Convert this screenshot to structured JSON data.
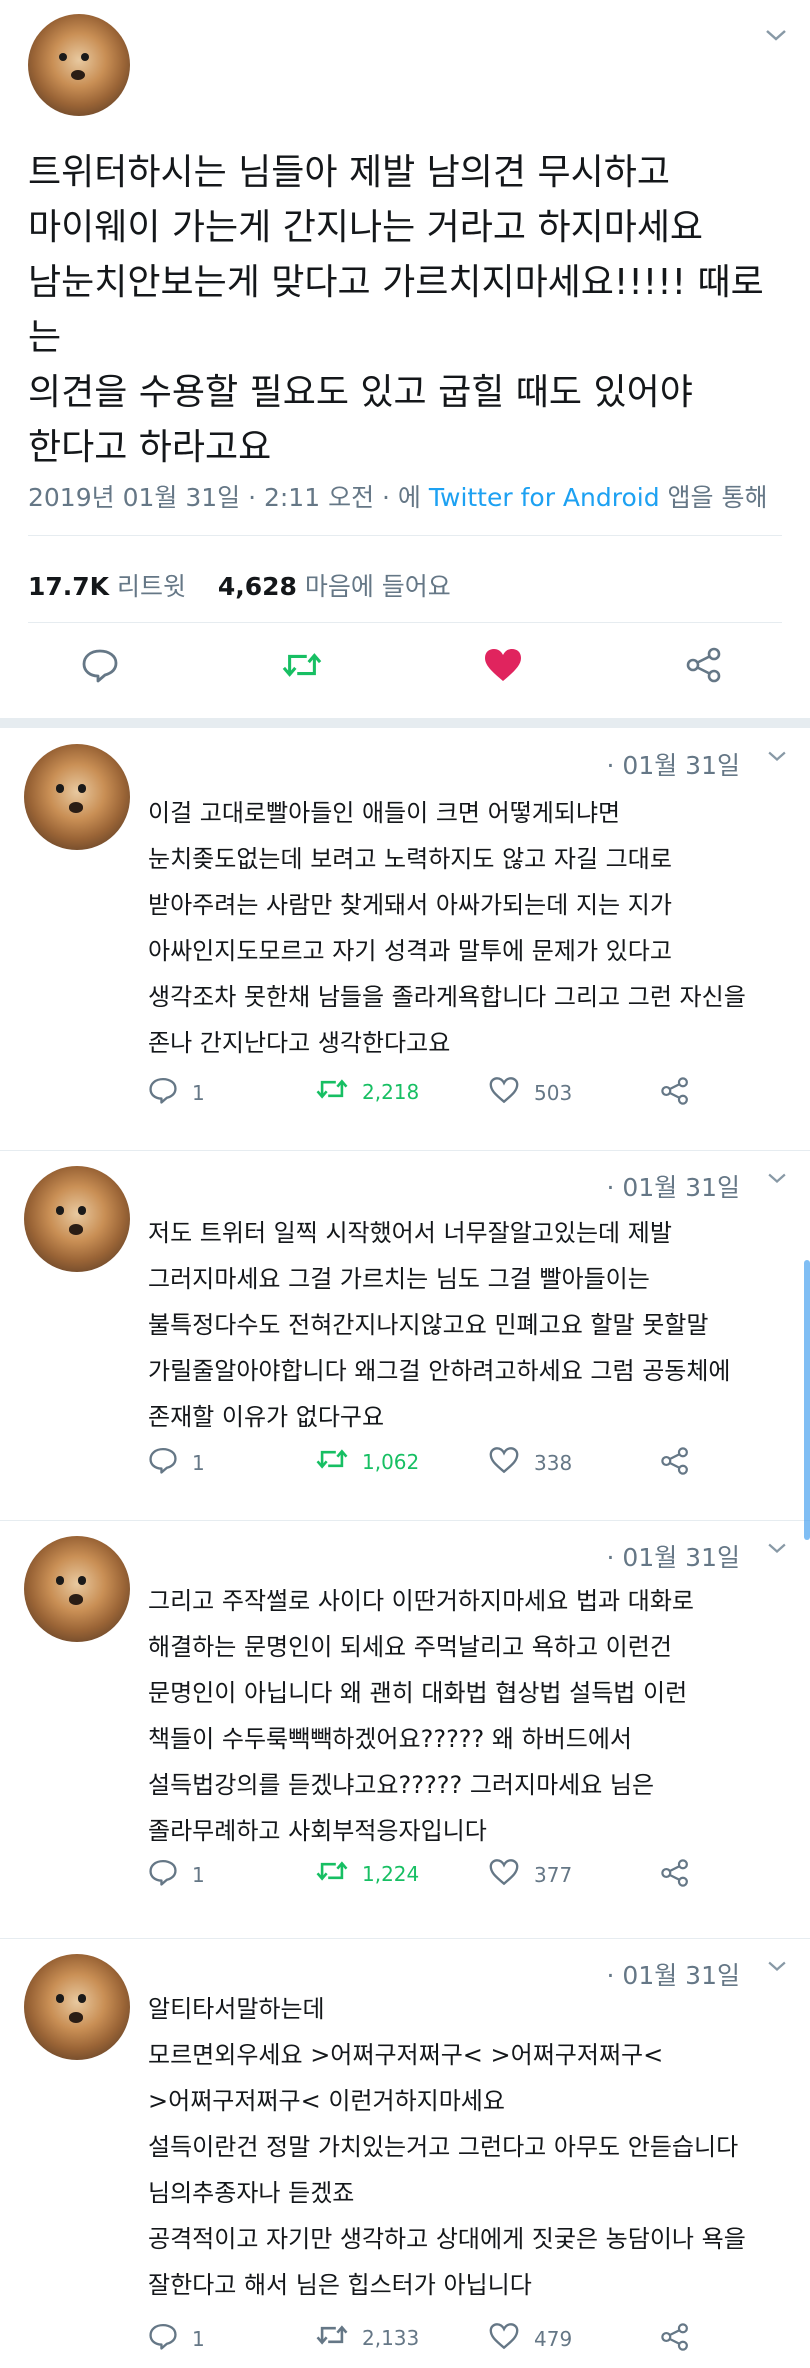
{
  "main_tweet": {
    "text": "트위터하시는 님들아 제발 남의견 무시하고\n마이웨이 가는게 간지나는 거라고 하지마세요\n남눈치안보는게 맞다고 가르치지마세요!!!!! 때로는\n의견을 수용할 필요도 있고 굽힐 때도 있어야\n한다고 하라고요",
    "date": "2019년 01월 31일 · 2:11 오전 · 에 ",
    "source": "Twitter for Android",
    "source_suffix": " 앱을 통해",
    "retweets_count": "17.7K",
    "retweets_label": " 리트윗",
    "likes_count": "4,628",
    "likes_label": " 마음에 들어요"
  },
  "icons": {
    "reply": "reply-icon",
    "retweet": "retweet-icon",
    "like": "heart-icon",
    "share": "share-icon",
    "menu": "chevron-down-icon"
  },
  "colors": {
    "accent": "#1da1f2",
    "retweet": "#17bf63",
    "like": "#e0245e",
    "muted": "#657786"
  },
  "replies": [
    {
      "date": "· 01월 31일",
      "text": "이걸 고대로빨아들인 애들이 크면 어떻게되냐면\n눈치좆도없는데 보려고 노력하지도 않고 자길 그대로\n받아주려는 사람만 찾게돼서 아싸가되는데 지는 지가\n아싸인지도모르고 자기 성격과 말투에 문제가 있다고\n생각조차 못한채 남들을 졸라게욕합니다 그리고 그런 자신을\n존나 간지난다고 생각한다고요",
      "replies": "1",
      "retweets": "2,218",
      "likes": "503"
    },
    {
      "date": "· 01월 31일",
      "text": "저도 트위터 일찍 시작했어서 너무잘알고있는데 제발\n그러지마세요 그걸 가르치는 님도 그걸 빨아들이는\n불특정다수도 전혀간지나지않고요 민폐고요 할말 못할말\n가릴줄알아야합니다 왜그걸 안하려고하세요 그럼 공동체에\n존재할 이유가 없다구요",
      "replies": "1",
      "retweets": "1,062",
      "likes": "338"
    },
    {
      "date": "· 01월 31일",
      "text": "그리고 주작썰로 사이다 이딴거하지마세요 법과 대화로\n해결하는 문명인이 되세요 주먹날리고 욕하고 이런건\n문명인이 아닙니다 왜 괜히 대화법 협상법 설득법 이런\n책들이 수두룩빽빽하겠어요????? 왜 하버드에서\n설득법강의를 듣겠냐고요????? 그러지마세요 님은\n졸라무례하고 사회부적응자입니다",
      "replies": "1",
      "retweets": "1,224",
      "likes": "377"
    },
    {
      "date": "· 01월 31일",
      "text": "알티타서말하는데\n모르면외우세요 >어쩌구저쩌구< >어쩌구저쩌구<\n>어쩌구저쩌구< 이런거하지마세요\n설득이란건 정말 가치있는거고 그런다고 아무도 안듣습니다\n님의추종자나 듣겠죠\n공격적이고 자기만 생각하고 상대에게 짓궂은 농담이나 욕을\n잘한다고 해서 님은 힙스터가 아닙니다",
      "replies": "1",
      "retweets": "2,133",
      "likes": "479"
    }
  ]
}
